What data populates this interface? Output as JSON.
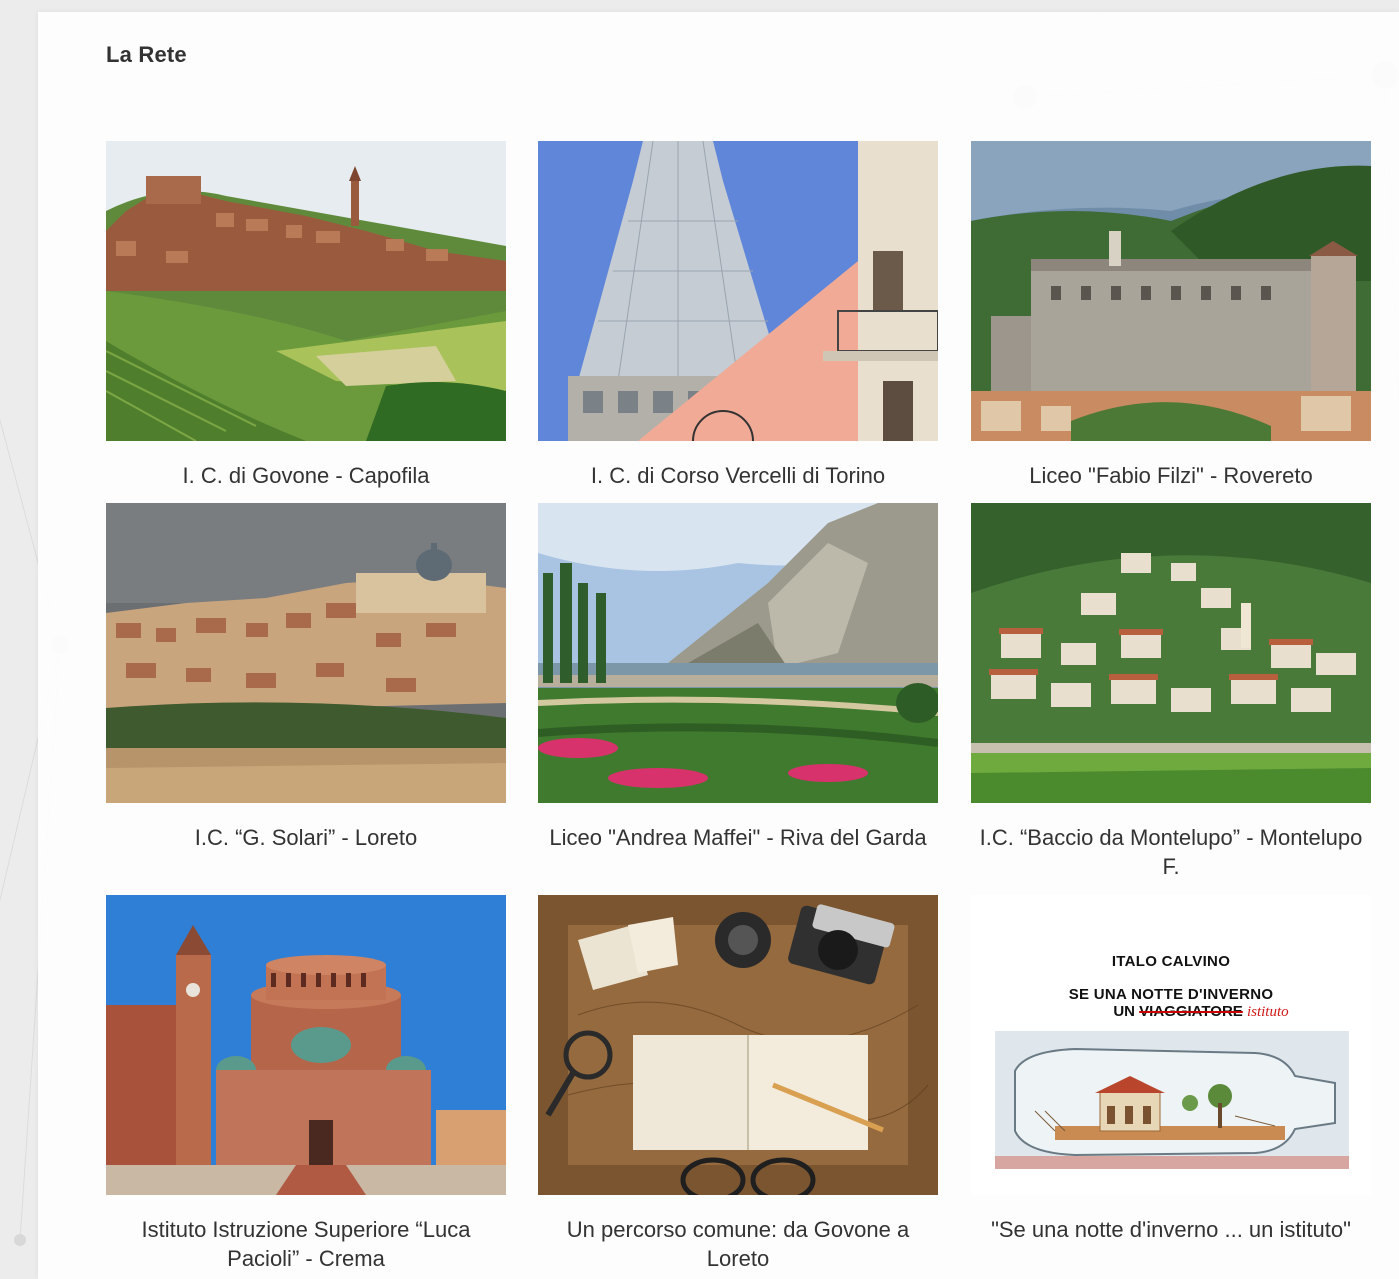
{
  "section": {
    "title": "La Rete"
  },
  "cards": [
    {
      "caption": "I. C. di Govone - Capofila",
      "image_alt": "hill town with vineyards"
    },
    {
      "caption": "I. C. di Corso Vercelli di Torino",
      "image_alt": "Mole Antonelliana spire"
    },
    {
      "caption": "Liceo \"Fabio Filzi\" - Rovereto",
      "image_alt": "castle of Rovereto"
    },
    {
      "caption": "I.C. “G. Solari” - Loreto",
      "image_alt": "Loreto town skyline"
    },
    {
      "caption": "Liceo \"Andrea Maffei\" - Riva del Garda",
      "image_alt": "lake garden and mountains"
    },
    {
      "caption": "I.C. “Baccio da Montelupo” - Montelupo F.",
      "image_alt": "hillside town"
    },
    {
      "caption": "Istituto Istruzione Superiore “Luca Pacioli” - Crema",
      "image_alt": "round basilica"
    },
    {
      "caption": "Un percorso comune: da Govone a Loreto",
      "image_alt": "travel notebook and camera"
    },
    {
      "caption": "\"Se una notte d'inverno ... un istituto\"",
      "image_alt": "book cover"
    }
  ],
  "poster": {
    "author": "ITALO CALVINO",
    "line1": "SE UNA NOTTE D'INVERNO",
    "line2_prefix": "UN",
    "struck": "VIAGGIATORE",
    "replacement": "istituto"
  }
}
